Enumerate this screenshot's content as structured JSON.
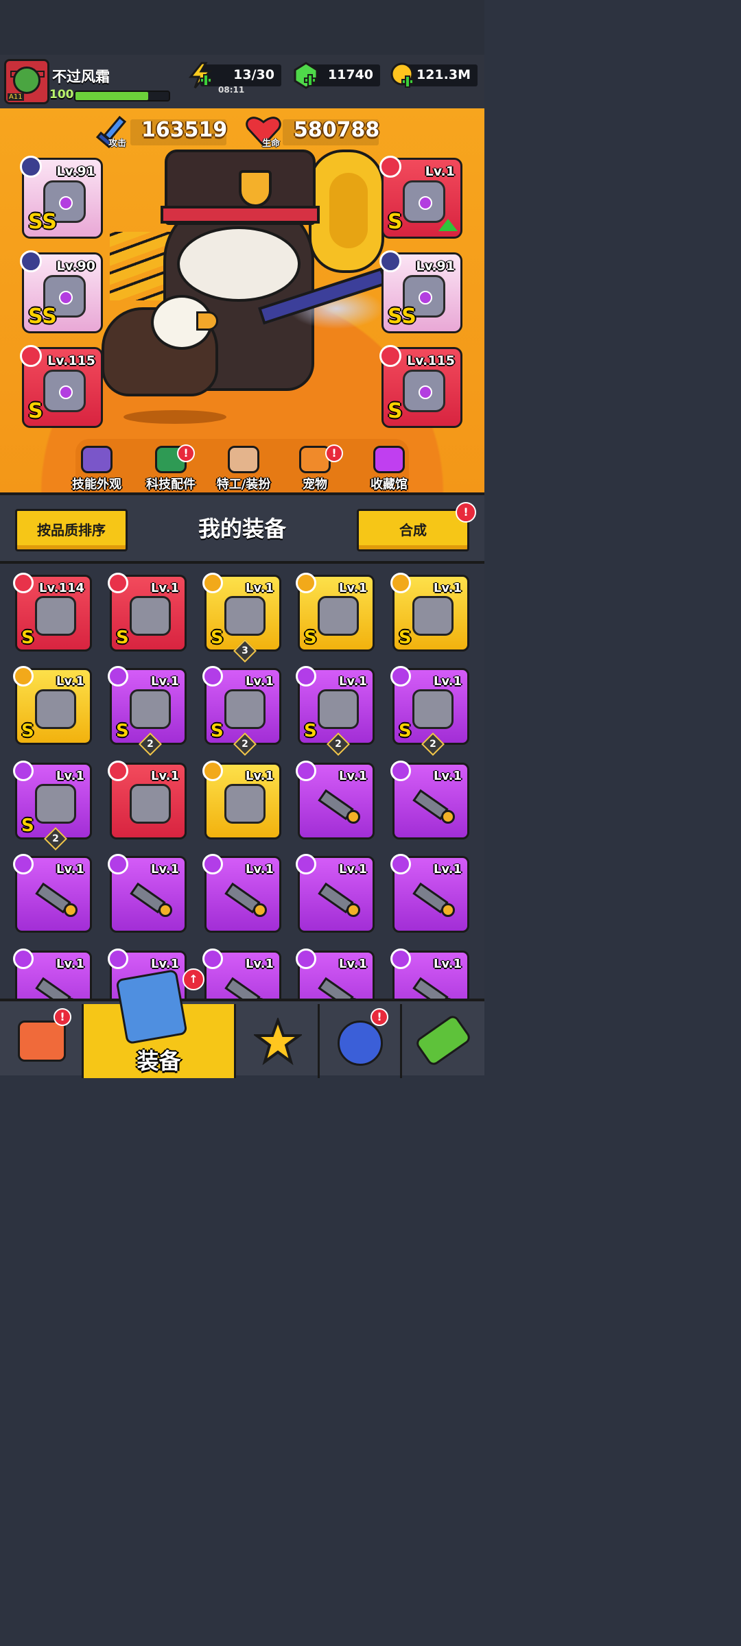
{
  "player": {
    "name": "不过风霜",
    "level": "100",
    "avatar_tag": "A11",
    "xp_fraction": 0.78
  },
  "resources": {
    "energy": "13/30",
    "energy_timer": "08:11",
    "gems": "11740",
    "coins": "121.3M"
  },
  "stats": {
    "attack_value": "163519",
    "attack_label": "攻击",
    "hp_value": "580788",
    "hp_label": "生命"
  },
  "equipped": [
    {
      "slot": "weapon",
      "level": "Lv.91",
      "grade": "SS",
      "color": "pink"
    },
    {
      "slot": "armor",
      "level": "Lv.1",
      "grade": "S",
      "color": "red",
      "upgrade": true
    },
    {
      "slot": "necklace",
      "level": "Lv.90",
      "grade": "SS",
      "color": "pink"
    },
    {
      "slot": "belt",
      "level": "Lv.91",
      "grade": "SS",
      "color": "pink"
    },
    {
      "slot": "gloves",
      "level": "Lv.115",
      "grade": "S",
      "color": "red"
    },
    {
      "slot": "boots",
      "level": "Lv.115",
      "grade": "S",
      "color": "red"
    }
  ],
  "categories": [
    {
      "label": "技能外观",
      "alert": false
    },
    {
      "label": "科技配件",
      "alert": true
    },
    {
      "label": "特工/装扮",
      "alert": false
    },
    {
      "label": "宠物",
      "alert": true
    },
    {
      "label": "收藏馆",
      "alert": false
    }
  ],
  "panel": {
    "sort_button": "按品质排序",
    "title": "我的装备",
    "merge_button": "合成",
    "merge_alert": "!"
  },
  "inventory": [
    {
      "level": "Lv.114",
      "grade": "S",
      "color": "red",
      "count": ""
    },
    {
      "level": "Lv.1",
      "grade": "S",
      "color": "red",
      "count": ""
    },
    {
      "level": "Lv.1",
      "grade": "S",
      "color": "gold",
      "count": "3"
    },
    {
      "level": "Lv.1",
      "grade": "S",
      "color": "gold",
      "count": ""
    },
    {
      "level": "Lv.1",
      "grade": "S",
      "color": "gold",
      "count": ""
    },
    {
      "level": "Lv.1",
      "grade": "S",
      "color": "gold",
      "count": ""
    },
    {
      "level": "Lv.1",
      "grade": "S",
      "color": "purple",
      "count": "2"
    },
    {
      "level": "Lv.1",
      "grade": "S",
      "color": "purple",
      "count": "2"
    },
    {
      "level": "Lv.1",
      "grade": "S",
      "color": "purple",
      "count": "2"
    },
    {
      "level": "Lv.1",
      "grade": "S",
      "color": "purple",
      "count": "2"
    },
    {
      "level": "Lv.1",
      "grade": "S",
      "color": "purple",
      "count": "2"
    },
    {
      "level": "Lv.1",
      "grade": "",
      "color": "red",
      "count": ""
    },
    {
      "level": "Lv.1",
      "grade": "",
      "color": "gold",
      "count": ""
    },
    {
      "level": "Lv.1",
      "grade": "",
      "color": "purple",
      "count": "",
      "kunai": true
    },
    {
      "level": "Lv.1",
      "grade": "",
      "color": "purple",
      "count": "",
      "kunai": true
    },
    {
      "level": "Lv.1",
      "grade": "",
      "color": "purple",
      "count": "",
      "kunai": true
    },
    {
      "level": "Lv.1",
      "grade": "",
      "color": "purple",
      "count": "",
      "kunai": true
    },
    {
      "level": "Lv.1",
      "grade": "",
      "color": "purple",
      "count": "",
      "kunai": true
    },
    {
      "level": "Lv.1",
      "grade": "",
      "color": "purple",
      "count": "",
      "kunai": true
    },
    {
      "level": "Lv.1",
      "grade": "",
      "color": "purple",
      "count": "",
      "kunai": true
    },
    {
      "level": "Lv.1",
      "grade": "",
      "color": "purple",
      "count": "",
      "kunai": true
    },
    {
      "level": "Lv.1",
      "grade": "",
      "color": "purple",
      "count": "",
      "kunai": true
    },
    {
      "level": "Lv.1",
      "grade": "",
      "color": "purple",
      "count": "",
      "kunai": true
    },
    {
      "level": "Lv.1",
      "grade": "",
      "color": "purple",
      "count": "",
      "kunai": true
    },
    {
      "level": "Lv.1",
      "grade": "",
      "color": "purple",
      "count": "",
      "kunai": true
    }
  ],
  "nav": {
    "equipment_label": "装备",
    "tabs": [
      "shop-icon",
      "equipment-icon",
      "talent-star-icon",
      "event-orb-icon",
      "lab-icon"
    ]
  },
  "colors": {
    "accent_yellow": "#f6c617",
    "hero_orange": "#f29a17",
    "rarity_red": "#ea3048",
    "rarity_gold": "#f8c71b",
    "rarity_purple": "#c03ff0",
    "alert_red": "#e82a3c"
  }
}
